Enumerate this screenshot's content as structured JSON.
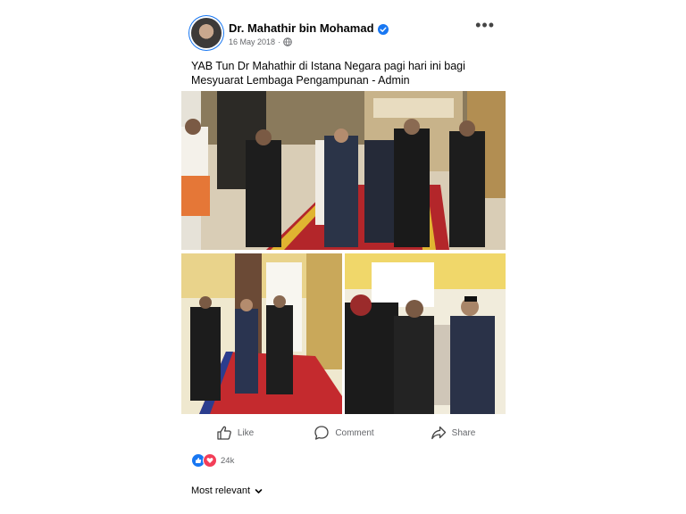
{
  "post": {
    "author": "Dr. Mahathir bin Mohamad",
    "date": "16 May 2018",
    "separator": "·",
    "more_label": "•••",
    "caption": "YAB Tun Dr Mahathir di Istana Negara pagi hari ini bagi Mesyuarat Lembaga Pengampunan - Admin"
  },
  "actions": {
    "like": "Like",
    "comment": "Comment",
    "share": "Share"
  },
  "reactions": {
    "count": "24k"
  },
  "comments": {
    "sort_label": "Most relevant"
  },
  "icons": {
    "verified": "verified-badge-icon",
    "privacy": "globe-icon",
    "like": "thumbs-up-icon",
    "comment": "speech-bubble-icon",
    "share": "share-arrow-icon",
    "sort": "chevron-down-icon"
  },
  "colors": {
    "brand": "#1877f2",
    "love": "#f33e58",
    "secondary_text": "#65676b"
  }
}
